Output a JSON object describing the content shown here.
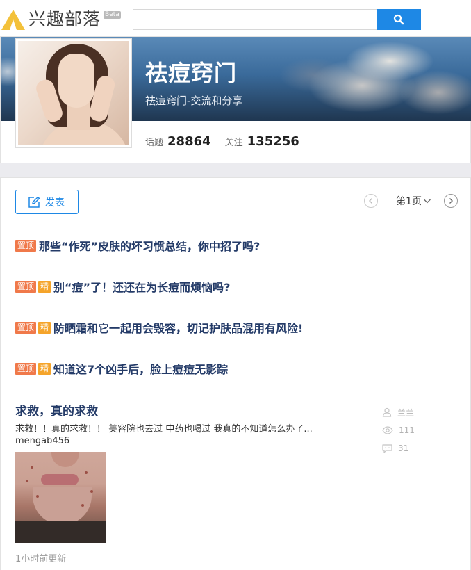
{
  "header": {
    "logo_text": "兴趣部落",
    "logo_badge": "Beta",
    "search_placeholder": "",
    "search_icon": "search-icon"
  },
  "tribe": {
    "name": "祛痘窍门",
    "subtitle": "祛痘窍门-交流和分享",
    "topics_label": "话题",
    "topics_count": "28864",
    "follow_label": "关注",
    "follow_count": "135256"
  },
  "toolbar": {
    "post_label": "发表",
    "page_label": "第1页"
  },
  "tags": {
    "top": "置顶",
    "best": "精"
  },
  "pinned": [
    {
      "title": "那些“作死”皮肤的坏习惯总结，你中招了吗?",
      "best": false
    },
    {
      "title": "别“痘”了！还还在为长痘而烦恼吗?",
      "best": true
    },
    {
      "title": "防晒霜和它一起用会毁容，切记护肤品混用有风险!",
      "best": true
    },
    {
      "title": "知道这7个凶手后，脸上痘痘无影踪",
      "best": true
    }
  ],
  "post": {
    "title": "求救，真的求救",
    "excerpt": "求救！！真的求救！！ 美容院也去过 中药也喝过 我真的不知道怎么办了...",
    "author": "mengab456",
    "meta_user": "兰兰",
    "views": "111",
    "comments": "31",
    "time": "1小时前更新"
  },
  "colors": {
    "accent": "#1e88e5",
    "title": "#243b68",
    "tag_top": "#f0794a",
    "tag_best": "#f5a42a",
    "logo": "#f3c13a"
  }
}
